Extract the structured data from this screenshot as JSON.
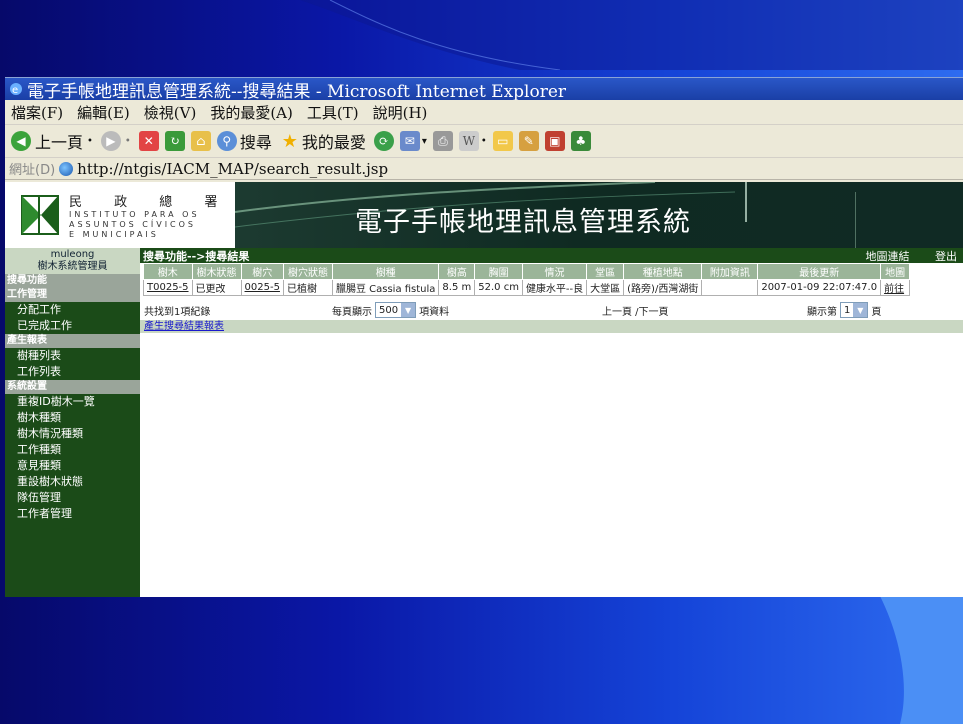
{
  "window": {
    "title": "電子手帳地理訊息管理系統--搜尋結果 - Microsoft Internet Explorer"
  },
  "menu": [
    "檔案(F)",
    "編輯(E)",
    "檢視(V)",
    "我的最愛(A)",
    "工具(T)",
    "說明(H)"
  ],
  "toolbar": {
    "back_label": "上一頁",
    "search_label": "搜尋",
    "favorites_label": "我的最愛"
  },
  "address": {
    "label": "網址(D)",
    "url": "http://ntgis/IACM_MAP/search_result.jsp"
  },
  "banner": {
    "logo_cn": "民 政 總 署",
    "logo_pt_lines": [
      "INSTITUTO PARA OS",
      "ASSUNTOS CÍVICOS",
      "E MUNICIPAIS"
    ],
    "system_title": "電子手帳地理訊息管理系統"
  },
  "sidebar": {
    "username": "muleong",
    "role": "樹木系統管理員",
    "sections": [
      {
        "title": "搜尋功能",
        "items": []
      },
      {
        "title": "工作管理",
        "items": [
          "分配工作",
          "已完成工作"
        ]
      },
      {
        "title": "產生報表",
        "items": [
          "樹種列表",
          "工作列表"
        ]
      },
      {
        "title": "系統設置",
        "items": [
          "重複ID樹木一覽",
          "樹木種類",
          "樹木情況種類",
          "工作種類",
          "意見種類",
          "重設樹木狀態",
          "隊伍管理",
          "工作者管理"
        ]
      }
    ]
  },
  "content": {
    "heading": "搜尋功能-->搜尋結果",
    "map_link": "地圖連結",
    "logout": "登出",
    "columns": [
      "樹木",
      "樹木狀態",
      "樹穴",
      "樹穴狀態",
      "樹種",
      "樹高",
      "胸圍",
      "情況",
      "堂區",
      "種植地點",
      "附加資訊",
      "最後更新",
      "地圖"
    ],
    "rows": [
      [
        "T0025-5",
        "已更改",
        "0025-5",
        "已植樹",
        "臘腸豆 Cassia fistula",
        "8.5 m",
        "52.0 cm",
        "健康水平--良",
        "大堂區",
        "(路旁)/西灣湖街",
        "",
        "2007-01-09 22:07:47.0",
        "前往"
      ]
    ],
    "found_text": "共找到1項紀錄",
    "per_page_prefix": "每頁顯示",
    "per_page_value": "500",
    "per_page_suffix": "項資料",
    "prev_next": "上一頁 /下一頁",
    "page_prefix": "顯示第",
    "page_value": "1",
    "page_suffix": "頁",
    "report_link": "產生搜尋結果報表"
  }
}
